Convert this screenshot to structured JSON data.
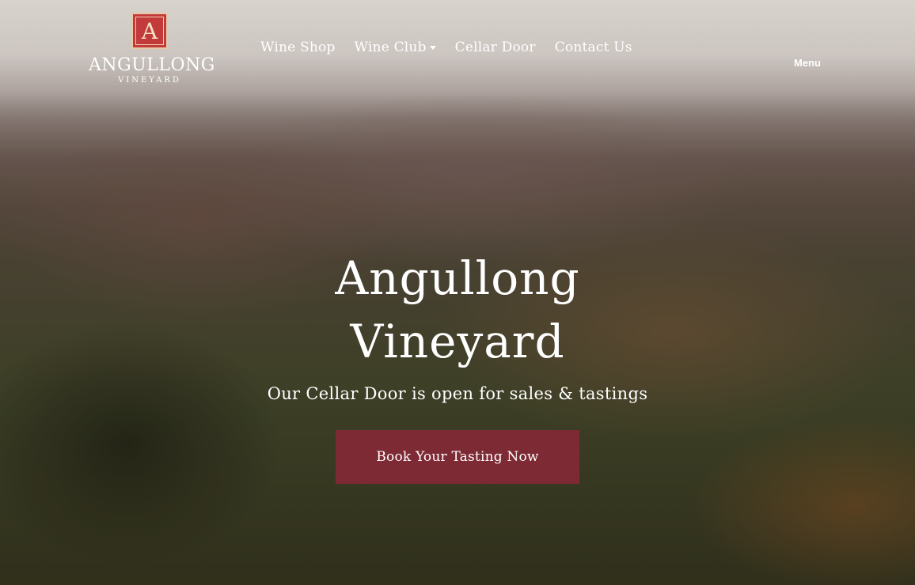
{
  "brand": {
    "logo_letter": "A",
    "name": "ANGULLONG",
    "subname": "VINEYARD",
    "colors": {
      "logo_red": "#c23a3a",
      "button_burgundy": "#7e2a34",
      "text": "#ffffff"
    }
  },
  "nav": {
    "items": [
      {
        "label": "Wine Shop"
      },
      {
        "label": "Wine Club",
        "dropdown": true
      },
      {
        "label": "Cellar Door"
      },
      {
        "label": "Contact Us"
      }
    ],
    "menu_label": "Menu"
  },
  "hero": {
    "title_line1": "Angullong",
    "title_line2": "Vineyard",
    "subtitle": "Our Cellar Door is open for sales & tastings",
    "cta_label": "Book Your Tasting Now"
  }
}
